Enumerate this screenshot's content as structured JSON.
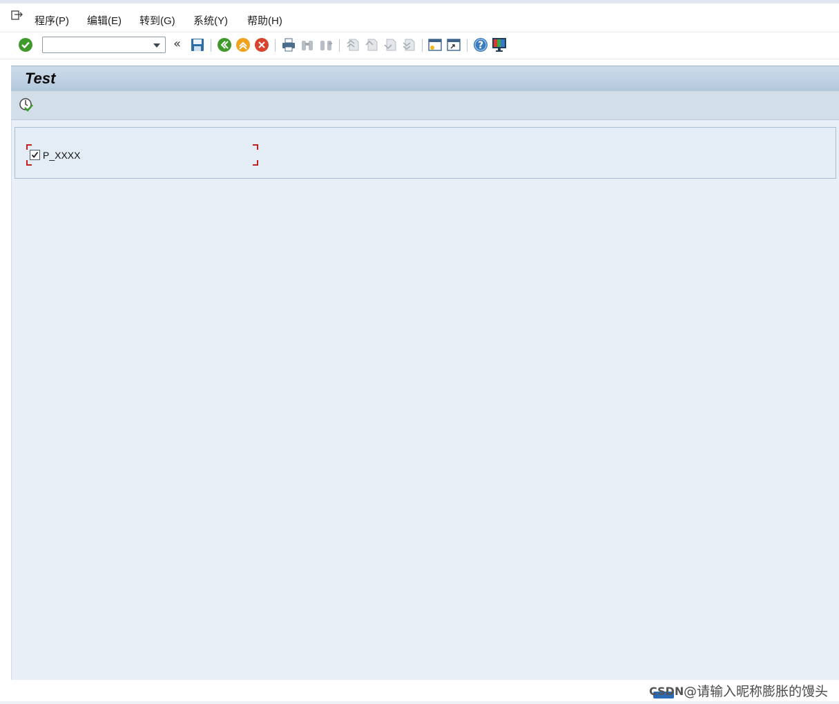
{
  "menubar": {
    "items": [
      {
        "label": "程序(P)"
      },
      {
        "label": "编辑(E)"
      },
      {
        "label": "转到(G)"
      },
      {
        "label": "系统(Y)"
      },
      {
        "label": "帮助(H)"
      }
    ]
  },
  "toolbar": {
    "command_field": {
      "value": "",
      "placeholder": ""
    },
    "collapse_glyph": "«",
    "icons": [
      "enter-icon",
      "save-icon",
      "back-icon",
      "exit-icon",
      "cancel-icon",
      "print-icon",
      "find-icon",
      "find-next-icon",
      "first-page-icon",
      "previous-page-icon",
      "next-page-icon",
      "last-page-icon",
      "create-session-icon",
      "create-shortcut-icon",
      "help-icon",
      "customize-layout-icon"
    ]
  },
  "title": {
    "text": "Test"
  },
  "app_toolbar": {
    "execute_icon": "execute-icon"
  },
  "selection_screen": {
    "checkbox": {
      "label": "P_XXXX",
      "checked": true
    }
  },
  "watermark": {
    "logo_text": "CSDN",
    "text": "@请输入昵称膨胀的馒头"
  },
  "colors": {
    "title_bar": "#b3c8dd",
    "content_bg": "#e8eff6",
    "app_toolbar": "#d2dfe9",
    "focus_corner": "#c02020"
  }
}
